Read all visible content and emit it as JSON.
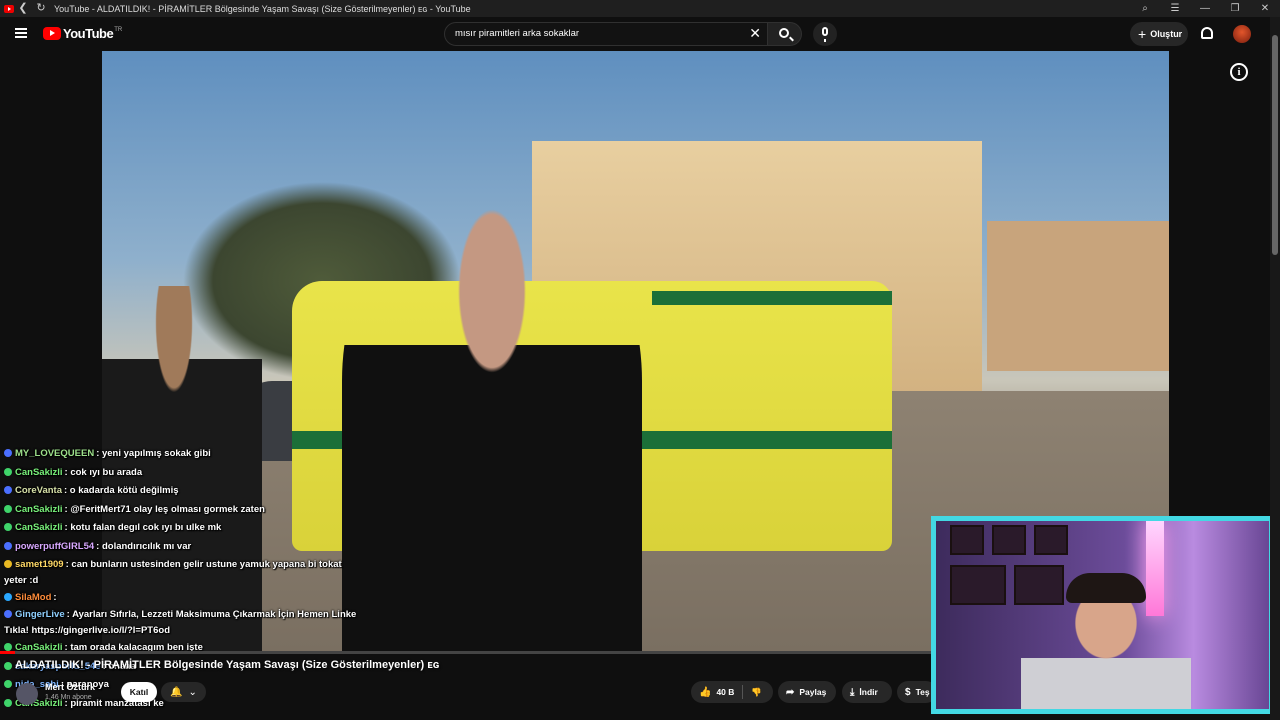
{
  "browser": {
    "tab_title": "YouTube - ALDATILDIK! - PİRAMİTLER Bölgesinde Yaşam Savaşı (Size Gösterilmeyenler) ᴇɢ - YouTube"
  },
  "masthead": {
    "logo_text": "YouTube",
    "logo_country": "TR",
    "search_value": "mısır piramitleri arka sokaklar",
    "create_label": "Oluştur"
  },
  "video": {
    "title": "ALDATILDIK! - PİRAMİTLER Bölgesinde Yaşam Savaşı (Size Gösterilmeyenler) ᴇɢ",
    "channel_name": "Mert Öztürk",
    "subscribers": "1,46 Mn abone",
    "join_label": "Katıl",
    "likes": "40 B",
    "share_label": "Paylaş",
    "download_label": "İndir",
    "thanks_label": "Teş",
    "progress_fraction": 0.012
  },
  "chat": [
    {
      "user": "MY_LOVEQUEEN",
      "color": "#9de08b",
      "badge": "#4b6fff",
      "text": ": yeni yapılmış sokak gibi"
    },
    {
      "user": "CanSakizli",
      "color": "#78f07a",
      "badge": "#3fd46a",
      "text": ": cok ıyı bu arada"
    },
    {
      "user": "CoreVanta",
      "color": "#d6e0a8",
      "badge": "#4b6fff",
      "text": ": o kadarda kötü değilmiş"
    },
    {
      "user": "CanSakizli",
      "color": "#78f07a",
      "badge": "#3fd46a",
      "text": ": @FeritMert71 olay leş olması gormek zaten"
    },
    {
      "user": "CanSakizli",
      "color": "#78f07a",
      "badge": "#3fd46a",
      "text": ": kotu falan degıl cok ıyı bı ulke mk"
    },
    {
      "user": "powerpuffGIRL54",
      "color": "#d8a8ff",
      "badge": "#4b6fff",
      "text": ": dolandırıcılık mı var"
    },
    {
      "user": "samet1909",
      "color": "#ffd966",
      "badge": "#e8b923",
      "text": ": can bunların ustesinden gelir ustune yamuk yapana bi tokat yeter :d"
    },
    {
      "user": "SilaMod",
      "color": "#ff8c3a",
      "badge": "#2aa8ff",
      "text": ":"
    },
    {
      "user": "GingerLive",
      "color": "#8fd0ff",
      "badge": "#4b6fff",
      "text": ": Ayarları Sıfırla, Lezzeti Maksimuma Çıkarmak İçin Hemen Linke Tıkla! https://gingerlive.io/l/?l=PT6od"
    },
    {
      "user": "CanSakizli",
      "color": "#78f07a",
      "badge": "#3fd46a",
      "text": ": tam orada kalacagım ben işte"
    },
    {
      "user": "sakaryasporlu_54e",
      "color": "#7fb6ff",
      "badge": "#3fd46a",
      "text": ": ohaaa"
    },
    {
      "user": "nida_sahi",
      "color": "#7fb6ff",
      "badge": "#3fd46a",
      "text": ": paranoya"
    },
    {
      "user": "CanSakizli",
      "color": "#78f07a",
      "badge": "#3fd46a",
      "text": ": piramit manzatası ke"
    }
  ],
  "colors": {
    "youtube_red": "#ff0000",
    "webcam_border": "#43d8e3"
  }
}
